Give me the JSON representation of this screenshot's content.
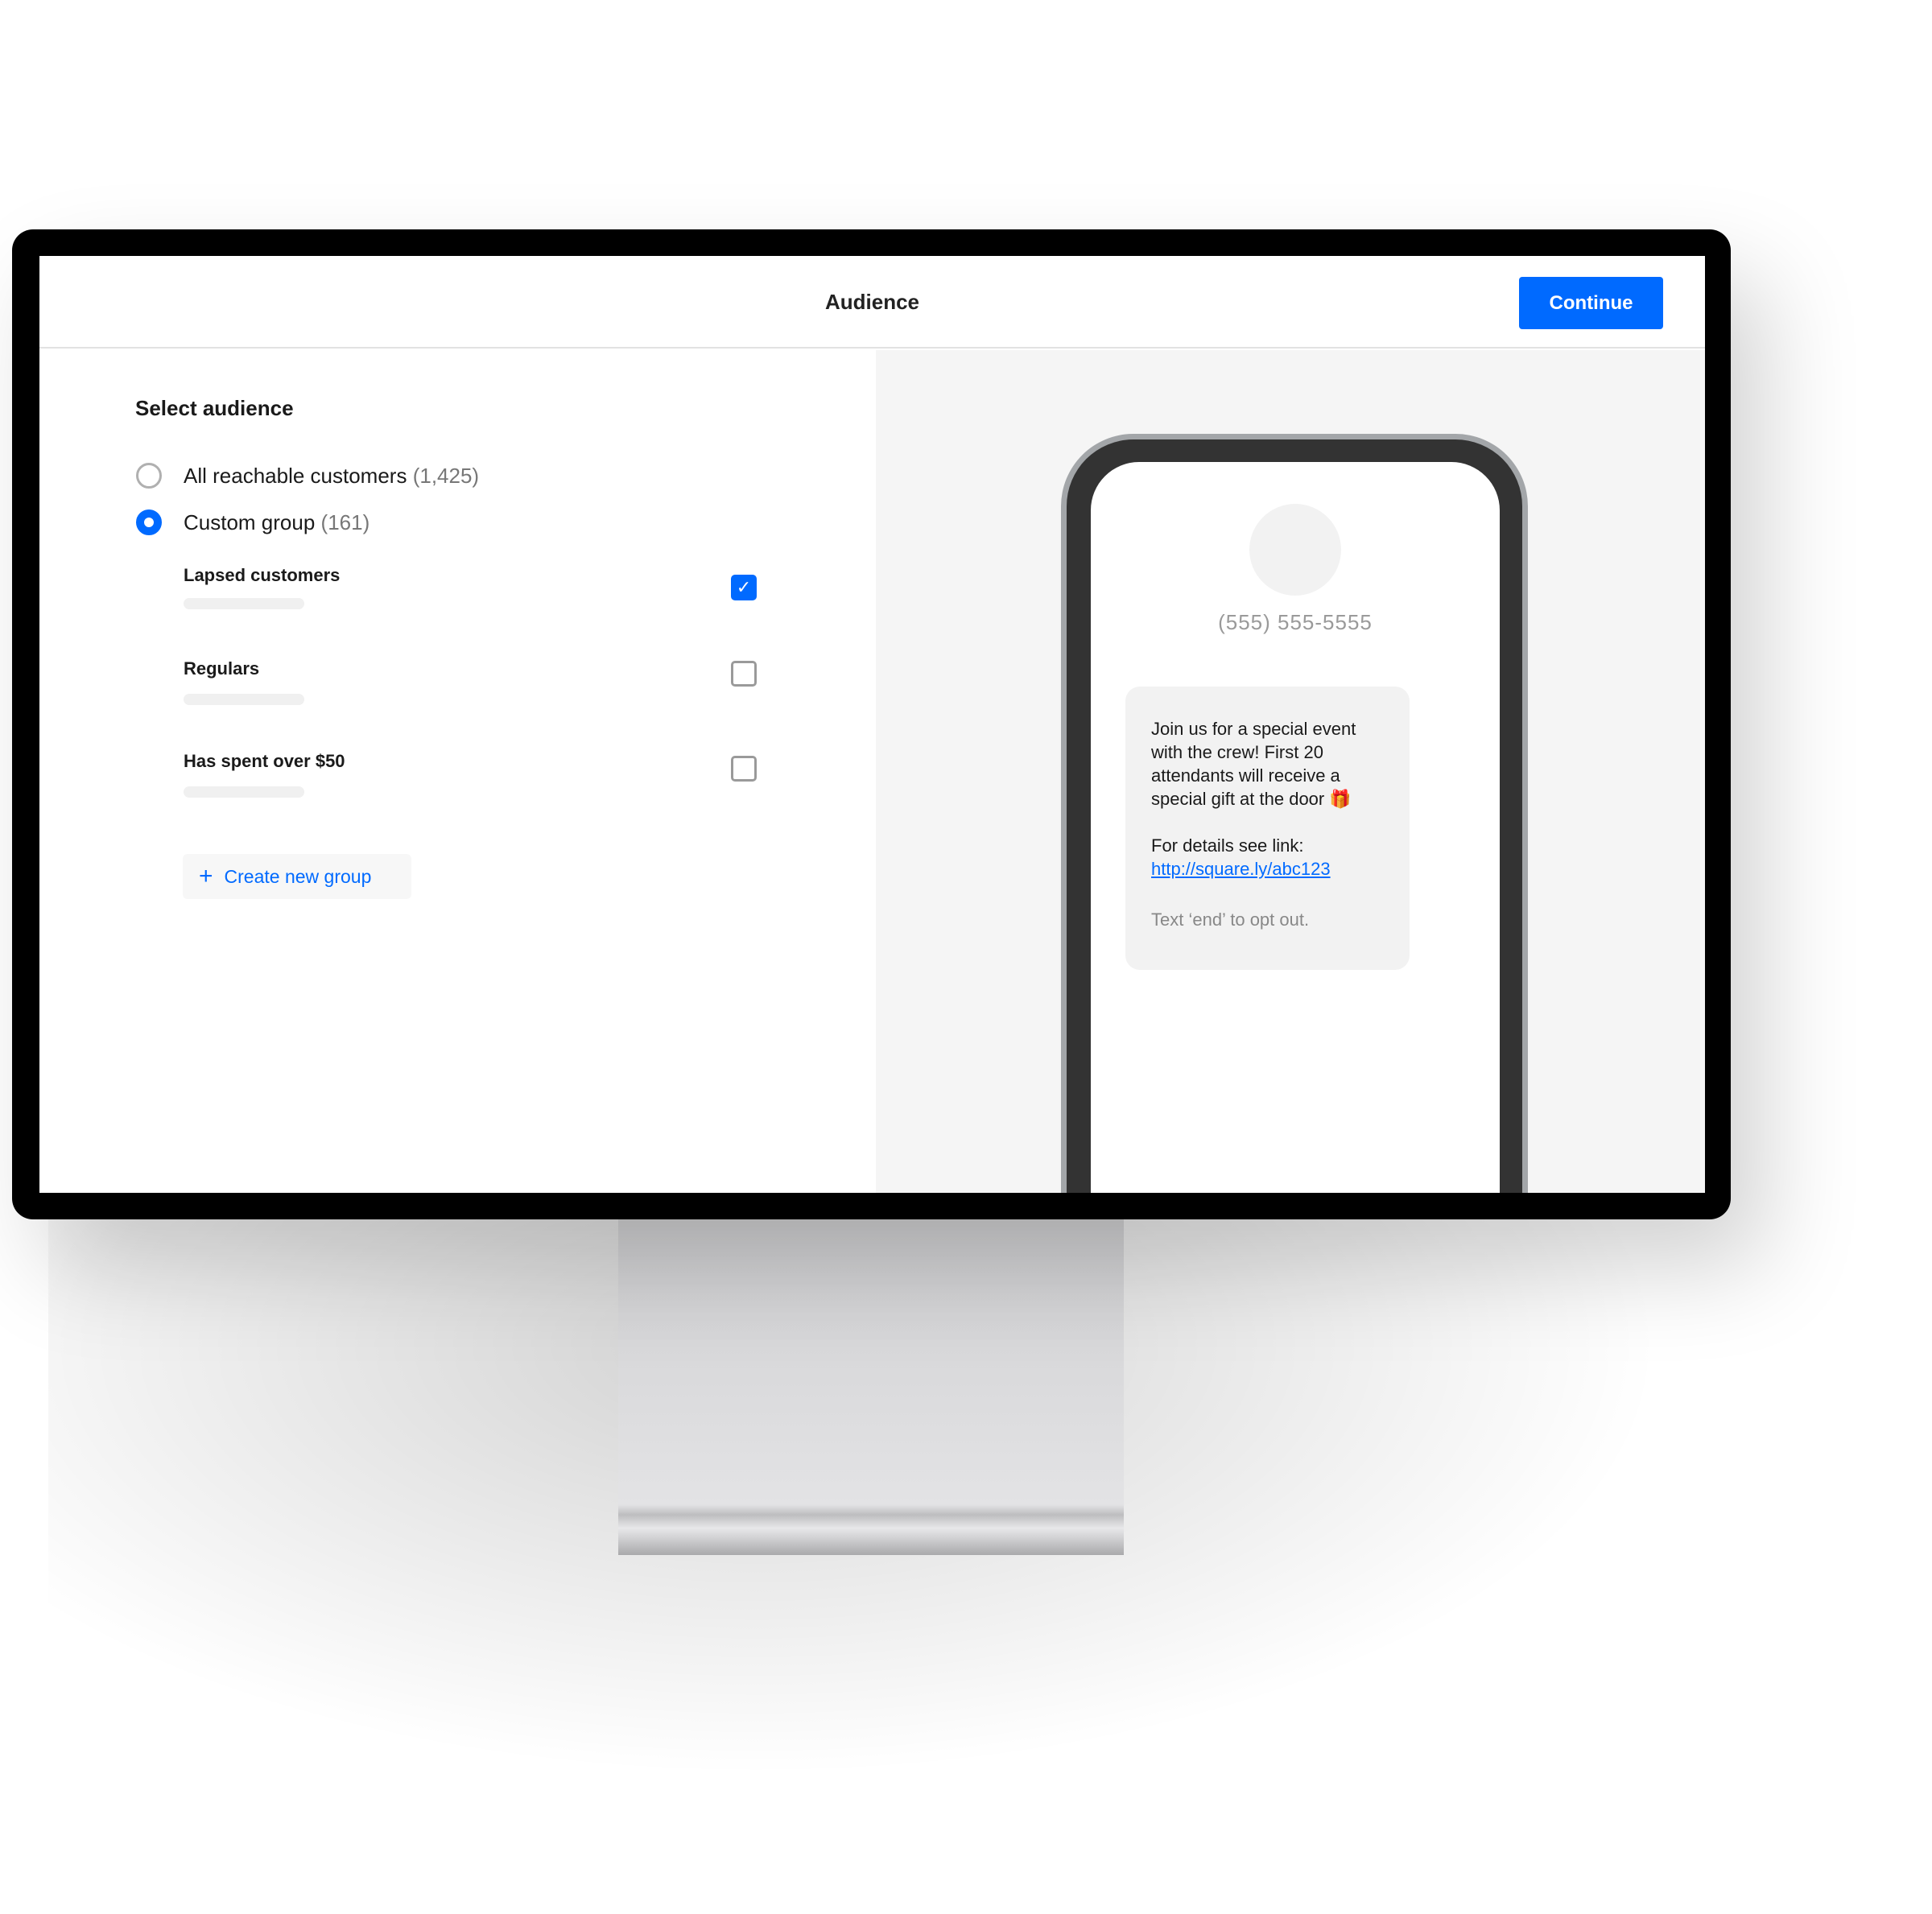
{
  "header": {
    "title": "Audience",
    "continue_label": "Continue"
  },
  "audience": {
    "heading": "Select audience",
    "options": [
      {
        "label": "All reachable customers",
        "count": "(1,425)",
        "selected": false
      },
      {
        "label": "Custom group",
        "count": "(161)",
        "selected": true
      }
    ],
    "groups": [
      {
        "label": "Lapsed customers",
        "checked": true
      },
      {
        "label": "Regulars",
        "checked": false
      },
      {
        "label": "Has spent over $50",
        "checked": false
      }
    ],
    "create_label": "Create new group"
  },
  "preview": {
    "phone_number": "(555) 555-5555",
    "message_lines": [
      "Join us for a special event",
      "with the crew! First 20",
      "attendants will receive a",
      "special gift at the door 🎁"
    ],
    "details_label": "For details see link:",
    "link": "http://square.ly/abc123",
    "opt_out": "Text ‘end’ to opt out."
  },
  "colors": {
    "accent": "#006aff"
  }
}
